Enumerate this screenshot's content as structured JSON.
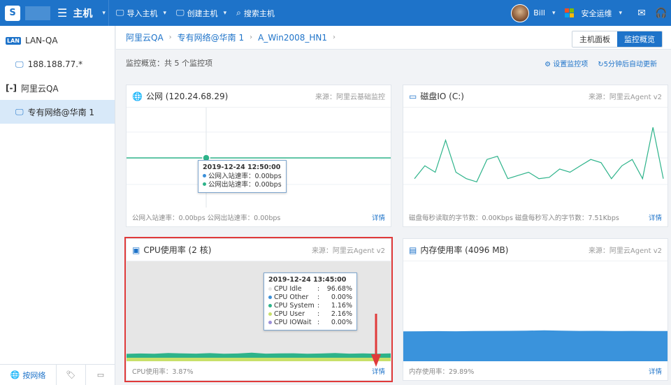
{
  "topbar": {
    "logo_text": "S",
    "module": "主机",
    "actions": [
      {
        "icon": "monitor-plus-icon",
        "label": "导入主机"
      },
      {
        "icon": "monitor-create-icon",
        "label": "创建主机"
      },
      {
        "icon": "search-host-icon",
        "label": "搜索主机"
      }
    ],
    "user": "Bill",
    "product": "安全运维"
  },
  "sidebar": {
    "items": [
      {
        "label": "LAN-QA",
        "type": "group",
        "badge": "LAN"
      },
      {
        "label": "188.188.77.*",
        "type": "child"
      },
      {
        "label": "阿里云QA",
        "type": "group"
      },
      {
        "label": "专有网络@华南 1",
        "type": "child",
        "active": true
      }
    ],
    "bottom_tabs": [
      {
        "label": "按网络",
        "icon": "globe-icon"
      },
      {
        "label": "",
        "icon": "tag-icon"
      },
      {
        "label": "",
        "icon": "folder-icon"
      }
    ]
  },
  "breadcrumb": [
    "阿里云QA",
    "专有网络@华南 1",
    "A_Win2008_HN1"
  ],
  "view_switch": {
    "host_panel": "主机面板",
    "monitor": "监控概览"
  },
  "summary": {
    "text": "监控概览：共 5 个监控项",
    "settings": "设置监控项",
    "refresh": "5分钟后自动更新"
  },
  "cards": [
    {
      "title": "公网 (120.24.68.29)",
      "source": "来源：阿里云基础监控",
      "footer": "公网入站速率：0.00bps 公网出站速率：0.00bps",
      "more": "详情",
      "tooltip": {
        "time": "2019-12-24 12:50:00",
        "rows": [
          {
            "label": "公网入站速率：0.00bps",
            "color": "#3b8fd8"
          },
          {
            "label": "公网出站速率：0.00bps",
            "color": "#2db38a"
          }
        ]
      }
    },
    {
      "title": "磁盘IO (C:)",
      "source": "来源：阿里云Agent v2",
      "footer": "磁盘每秒读取的字节数：0.00Kbps 磁盘每秒写入的字节数：7.51Kbps",
      "more": "详情"
    },
    {
      "title": "CPU使用率 (2 核)",
      "source": "来源：阿里云Agent v2",
      "footer": "CPU使用率：3.87%",
      "more": "详情",
      "tooltip": {
        "time": "2019-12-24 13:45:00",
        "rows": [
          {
            "name": "CPU Idle",
            "value": "96.68%",
            "color": "#e6e6e6"
          },
          {
            "name": "CPU Other",
            "value": "0.00%",
            "color": "#3b8fd8"
          },
          {
            "name": "CPU System",
            "value": "1.16%",
            "color": "#2db38a"
          },
          {
            "name": "CPU User",
            "value": "2.16%",
            "color": "#c8e06a"
          },
          {
            "name": "CPU IOWait",
            "value": "0.00%",
            "color": "#9b8fd8"
          }
        ]
      }
    },
    {
      "title": "内存使用率 (4096 MB)",
      "source": "来源：阿里云Agent v2",
      "footer": "内存使用率：29.89%",
      "more": "详情"
    }
  ],
  "chart_data": [
    {
      "type": "line",
      "series": [
        {
          "values": [
            0,
            0,
            0,
            0,
            0,
            0,
            0,
            0,
            0,
            0,
            0,
            0,
            0,
            0,
            0,
            0,
            0,
            0,
            0,
            0,
            0,
            0,
            0,
            0,
            0
          ]
        }
      ]
    },
    {
      "type": "line",
      "series": [
        {
          "values": [
            2,
            4,
            3,
            8,
            3,
            2,
            1.5,
            5,
            5.5,
            2,
            2.5,
            3,
            2,
            2.2,
            3.5,
            3,
            4,
            5,
            4.5,
            2,
            4,
            5,
            2,
            10,
            2
          ]
        }
      ]
    },
    {
      "type": "area",
      "series": [
        {
          "values": [
            3.5,
            3.8,
            3.6,
            4.2,
            3.9,
            3.7,
            4.1,
            3.6,
            3.8,
            4.5,
            3.7,
            3.9,
            4.0,
            3.6,
            3.8,
            4.2,
            3.7,
            3.9,
            3.6,
            3.87
          ]
        }
      ]
    },
    {
      "type": "area",
      "series": [
        {
          "values": [
            29.5,
            29.6,
            29.7,
            29.6,
            29.8,
            29.9,
            30.0,
            30.2,
            30.5,
            30.2,
            29.9,
            30.0,
            29.8,
            29.9,
            29.8,
            29.89
          ]
        }
      ]
    }
  ],
  "colors": {
    "brand": "#1e73c9",
    "active_bg": "#d8e9f9",
    "highlight": "#e03a3a"
  }
}
